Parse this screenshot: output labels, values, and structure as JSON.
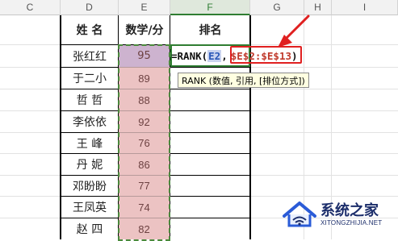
{
  "column_headers": [
    "C",
    "D",
    "E",
    "F",
    "G",
    "H",
    "I"
  ],
  "table": {
    "headers": [
      "姓  名",
      "数学/分",
      "排名"
    ],
    "rows": [
      {
        "name": "张红红",
        "score": "95"
      },
      {
        "name": "于二小",
        "score": "89"
      },
      {
        "name": "哲  哲",
        "score": "88"
      },
      {
        "name": "李依依",
        "score": "92"
      },
      {
        "name": "王  峰",
        "score": "76"
      },
      {
        "name": "丹  妮",
        "score": "86"
      },
      {
        "name": "邓盼盼",
        "score": "77"
      },
      {
        "name": "王凤英",
        "score": "74"
      },
      {
        "name": "赵  四",
        "score": "82"
      }
    ]
  },
  "formula": {
    "prefix": "=RANK(",
    "arg1": "E2",
    "separator": ",",
    "arg2": "$E$2:$E$13",
    "suffix": ")"
  },
  "tooltip": "RANK (数值, 引用, [排位方式])",
  "watermark": {
    "title": "系统之家",
    "subtitle": "XITONGZHIJIA.NET"
  },
  "colors": {
    "score_fill": "#ecc3c3",
    "selection_ants": "#4a8a3c",
    "highlight_box": "#e02020",
    "active_column": "#2f7d32"
  },
  "icons": [
    "red-arrow-icon",
    "house-logo-icon"
  ]
}
